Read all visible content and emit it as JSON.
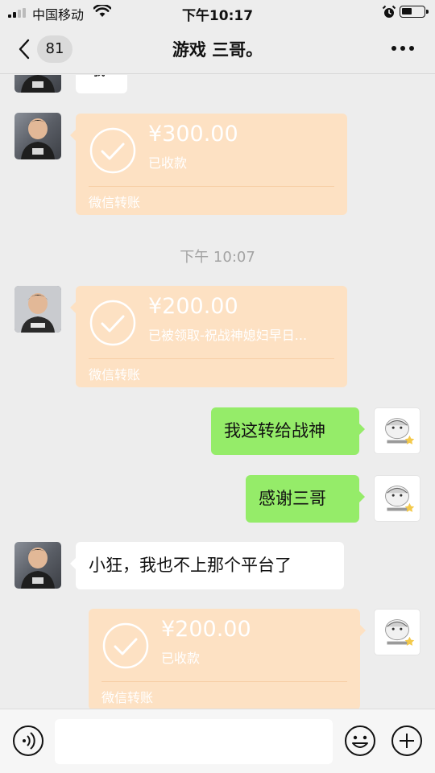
{
  "status_bar": {
    "carrier": "中国移动",
    "time": "下午10:17"
  },
  "header": {
    "back_count": "81",
    "title": "游戏 三哥。"
  },
  "messages": [
    {
      "type": "text",
      "side": "left",
      "text": "哦"
    },
    {
      "type": "transfer",
      "side": "left",
      "amount": "¥300.00",
      "status": "已收款",
      "footer": "微信转账"
    },
    {
      "type": "time",
      "text": "下午 10:07"
    },
    {
      "type": "transfer",
      "side": "left",
      "amount": "¥200.00",
      "status": "已被领取-祝战神媳妇早日...",
      "footer": "微信转账"
    },
    {
      "type": "text",
      "side": "right",
      "text": "我这转给战神"
    },
    {
      "type": "text",
      "side": "right",
      "text": "感谢三哥"
    },
    {
      "type": "text",
      "side": "left",
      "text": "小狂，我也不上那个平台了"
    },
    {
      "type": "transfer",
      "side": "right",
      "amount": "¥200.00",
      "status": "已收款",
      "footer": "微信转账"
    }
  ],
  "input_bar": {
    "placeholder": ""
  },
  "colors": {
    "background": "#ededed",
    "sent_bubble": "#95ec69",
    "received_bubble": "#ffffff",
    "transfer_card": "#fde1c3"
  }
}
